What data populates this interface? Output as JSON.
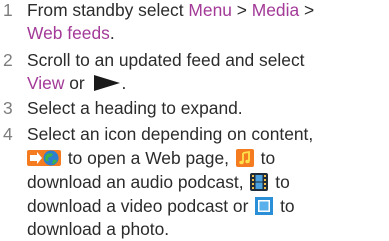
{
  "steps": [
    {
      "number": "1",
      "line1_prefix": "From standby select ",
      "link_menu": "Menu",
      "sep1": " > ",
      "link_media": "Media",
      "sep2": " >",
      "link_web_feeds": "Web feeds",
      "line2_suffix": "."
    },
    {
      "number": "2",
      "line1": "Scroll to an updated feed and select",
      "link_view": "View",
      "or_text": " or ",
      "arrow_icon": "play-arrow-icon",
      "line2_suffix": "."
    },
    {
      "number": "3",
      "line1": "Select a heading to expand."
    },
    {
      "number": "4",
      "line1": "Select an icon depending on content,",
      "web_icon": "web-page-icon",
      "to_web": " to open a Web page, ",
      "audio_icon": "audio-podcast-icon",
      "to_word": " to",
      "line3_prefix": "download an audio podcast, ",
      "video_icon": "video-podcast-icon",
      "line3_suffix": " to",
      "line4_prefix": "download a video podcast or ",
      "photo_icon": "photo-icon",
      "line4_suffix": " to",
      "line5": "download a photo."
    }
  ],
  "colors": {
    "text": "#2b2b2b",
    "number": "#7d7d7d",
    "link": "#a33a98",
    "audio_icon_bg": "#f47b20",
    "video_icon_bg": "#1f2d3a",
    "photo_icon_bg": "#2a8fd6"
  }
}
